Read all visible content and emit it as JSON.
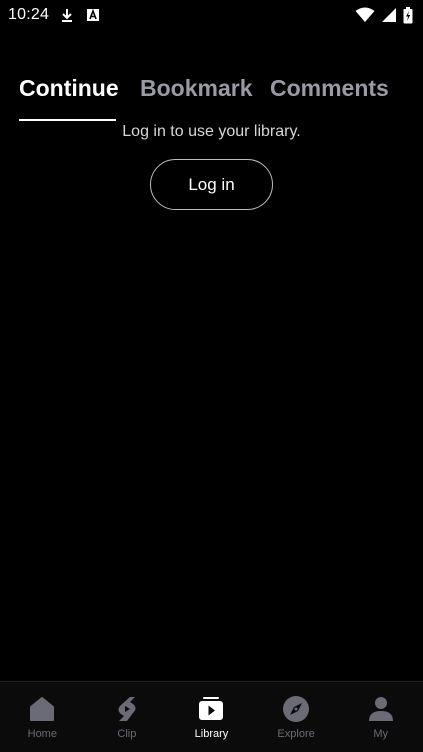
{
  "status_bar": {
    "time": "10:24",
    "icons": [
      "download-icon",
      "a-notification-icon",
      "wifi-icon",
      "signal-icon",
      "battery-charging-icon"
    ]
  },
  "tabs": [
    {
      "label": "Continue",
      "active": true
    },
    {
      "label": "Bookmark",
      "active": false
    },
    {
      "label": "Comments",
      "active": false
    }
  ],
  "main": {
    "message": "Log in to use your library.",
    "login_button": "Log in"
  },
  "bottom_nav": {
    "items": [
      {
        "label": "Home",
        "icon": "home-icon",
        "active": false
      },
      {
        "label": "Clip",
        "icon": "clip-icon",
        "active": false
      },
      {
        "label": "Library",
        "icon": "library-icon",
        "active": true
      },
      {
        "label": "Explore",
        "icon": "compass-icon",
        "active": false
      },
      {
        "label": "My",
        "icon": "person-icon",
        "active": false
      }
    ]
  },
  "colors": {
    "background": "#000000",
    "active_text": "#ffffff",
    "inactive_tab": "#9a9aa6",
    "inactive_nav": "#6b6b78"
  }
}
